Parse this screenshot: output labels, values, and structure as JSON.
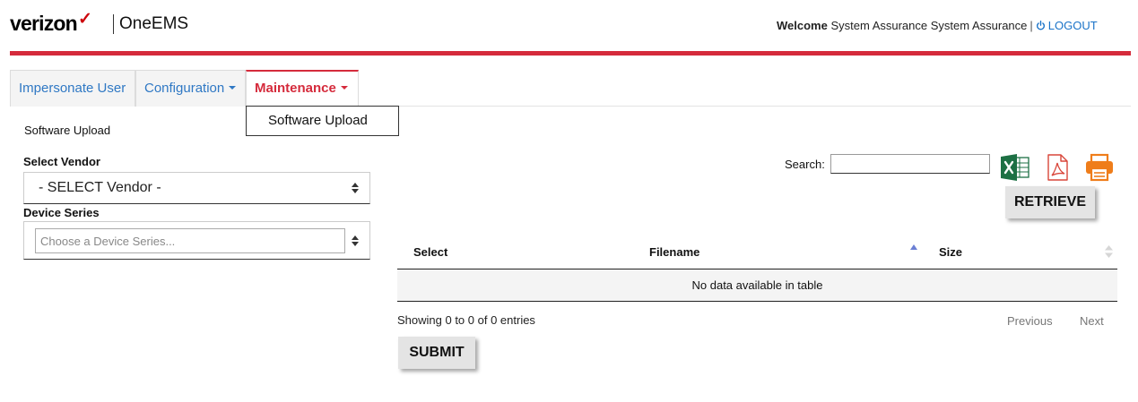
{
  "header": {
    "logo_text": "verizon",
    "logo_check": "✓",
    "app_name": "OneEMS",
    "welcome_label": "Welcome",
    "user_name": "System Assurance System Assurance",
    "separator": "|",
    "logout_label": "LOGOUT",
    "brand_color": "#d52b3c"
  },
  "tabs": [
    {
      "label": "Impersonate User",
      "active": false
    },
    {
      "label": "Configuration",
      "active": false,
      "has_dropdown": true
    },
    {
      "label": "Maintenance",
      "active": true,
      "has_dropdown": true
    }
  ],
  "dropdown_menu": {
    "items": [
      "Software Upload"
    ]
  },
  "page": {
    "title": "Software Upload"
  },
  "form": {
    "vendor_label": "Select Vendor",
    "vendor_value": "- SELECT Vendor -",
    "series_label": "Device Series",
    "series_placeholder": "Choose a Device Series..."
  },
  "toolbar": {
    "search_label": "Search:",
    "search_value": "",
    "export_icons": [
      "excel-icon",
      "pdf-icon",
      "print-icon"
    ],
    "retrieve_label": "RETRIEVE"
  },
  "table": {
    "columns": [
      "Select",
      "Filename",
      "Size"
    ],
    "empty_message": "No data available in table",
    "info": "Showing 0 to 0 of 0 entries",
    "prev_label": "Previous",
    "next_label": "Next"
  },
  "actions": {
    "submit_label": "SUBMIT"
  }
}
